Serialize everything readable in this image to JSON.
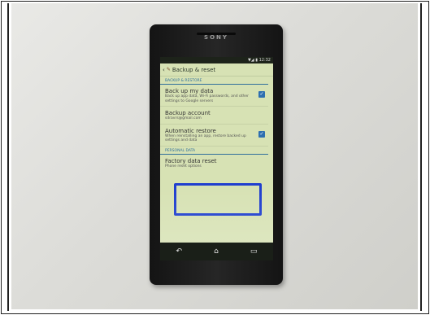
{
  "phone": {
    "brand": "SONY",
    "status_time": "12:32"
  },
  "screen": {
    "title": "Backup & reset",
    "sections": [
      {
        "header": "BACKUP & RESTORE",
        "items": [
          {
            "title": "Back up my data",
            "subtitle": "Back up app data, Wi-Fi passwords, and other settings to Google servers",
            "checked": true
          },
          {
            "title": "Backup account",
            "subtitle": "sdravrs@gmail.com",
            "checked": null
          },
          {
            "title": "Automatic restore",
            "subtitle": "When reinstalling an app, restore backed up settings and data",
            "checked": true
          }
        ]
      },
      {
        "header": "PERSONAL DATA",
        "items": [
          {
            "title": "Factory data reset",
            "subtitle": "Phone reset options",
            "checked": null
          }
        ]
      }
    ]
  },
  "navbar": {
    "back_icon": "↶",
    "home_icon": "⌂",
    "recent_icon": "▭"
  },
  "colors": {
    "highlight": "#1f3fcf",
    "checkbox": "#2e6fb0",
    "section_header": "#2f6f9b",
    "screen_background": "#d7e2b4"
  }
}
